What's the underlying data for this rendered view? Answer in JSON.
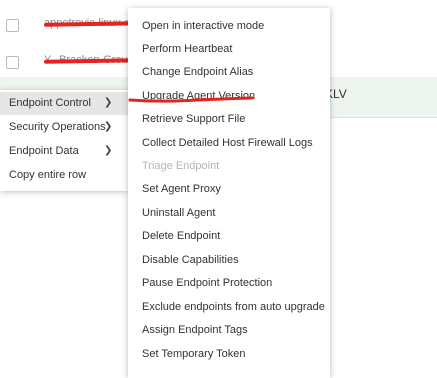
{
  "table": {
    "rows": [
      {
        "name": "appetrovic-linux-no"
      },
      {
        "name": "Y...Bracken-Group"
      },
      {
        "tail": "KLV"
      }
    ]
  },
  "context_menu": {
    "items": [
      {
        "label": "Endpoint Control",
        "has_submenu": true
      },
      {
        "label": "Security Operations",
        "has_submenu": true
      },
      {
        "label": "Endpoint Data",
        "has_submenu": true
      },
      {
        "label": "Copy entire row",
        "has_submenu": false
      }
    ],
    "chevron": "chevron-right-icon"
  },
  "submenu": {
    "items": [
      {
        "label": "Open in interactive mode"
      },
      {
        "label": "Perform Heartbeat"
      },
      {
        "label": "Change Endpoint Alias"
      },
      {
        "label": "Upgrade Agent Version"
      },
      {
        "label": "Retrieve Support File"
      },
      {
        "label": "Collect Detailed Host Firewall Logs"
      },
      {
        "label": "Triage Endpoint",
        "disabled": true
      },
      {
        "label": "Set Agent Proxy"
      },
      {
        "label": "Uninstall Agent"
      },
      {
        "label": "Delete Endpoint"
      },
      {
        "label": "Disable Capabilities"
      },
      {
        "label": "Pause Endpoint Protection"
      },
      {
        "label": "Exclude endpoints from auto upgrade"
      },
      {
        "label": "Assign Endpoint Tags"
      },
      {
        "label": "Set Temporary Token"
      }
    ]
  },
  "colors": {
    "annotation_red": "#e52420",
    "active_item_bg": "#e6e6e6",
    "disabled_text": "#b5b5b5",
    "selected_row_bg": "#eef5ef"
  }
}
